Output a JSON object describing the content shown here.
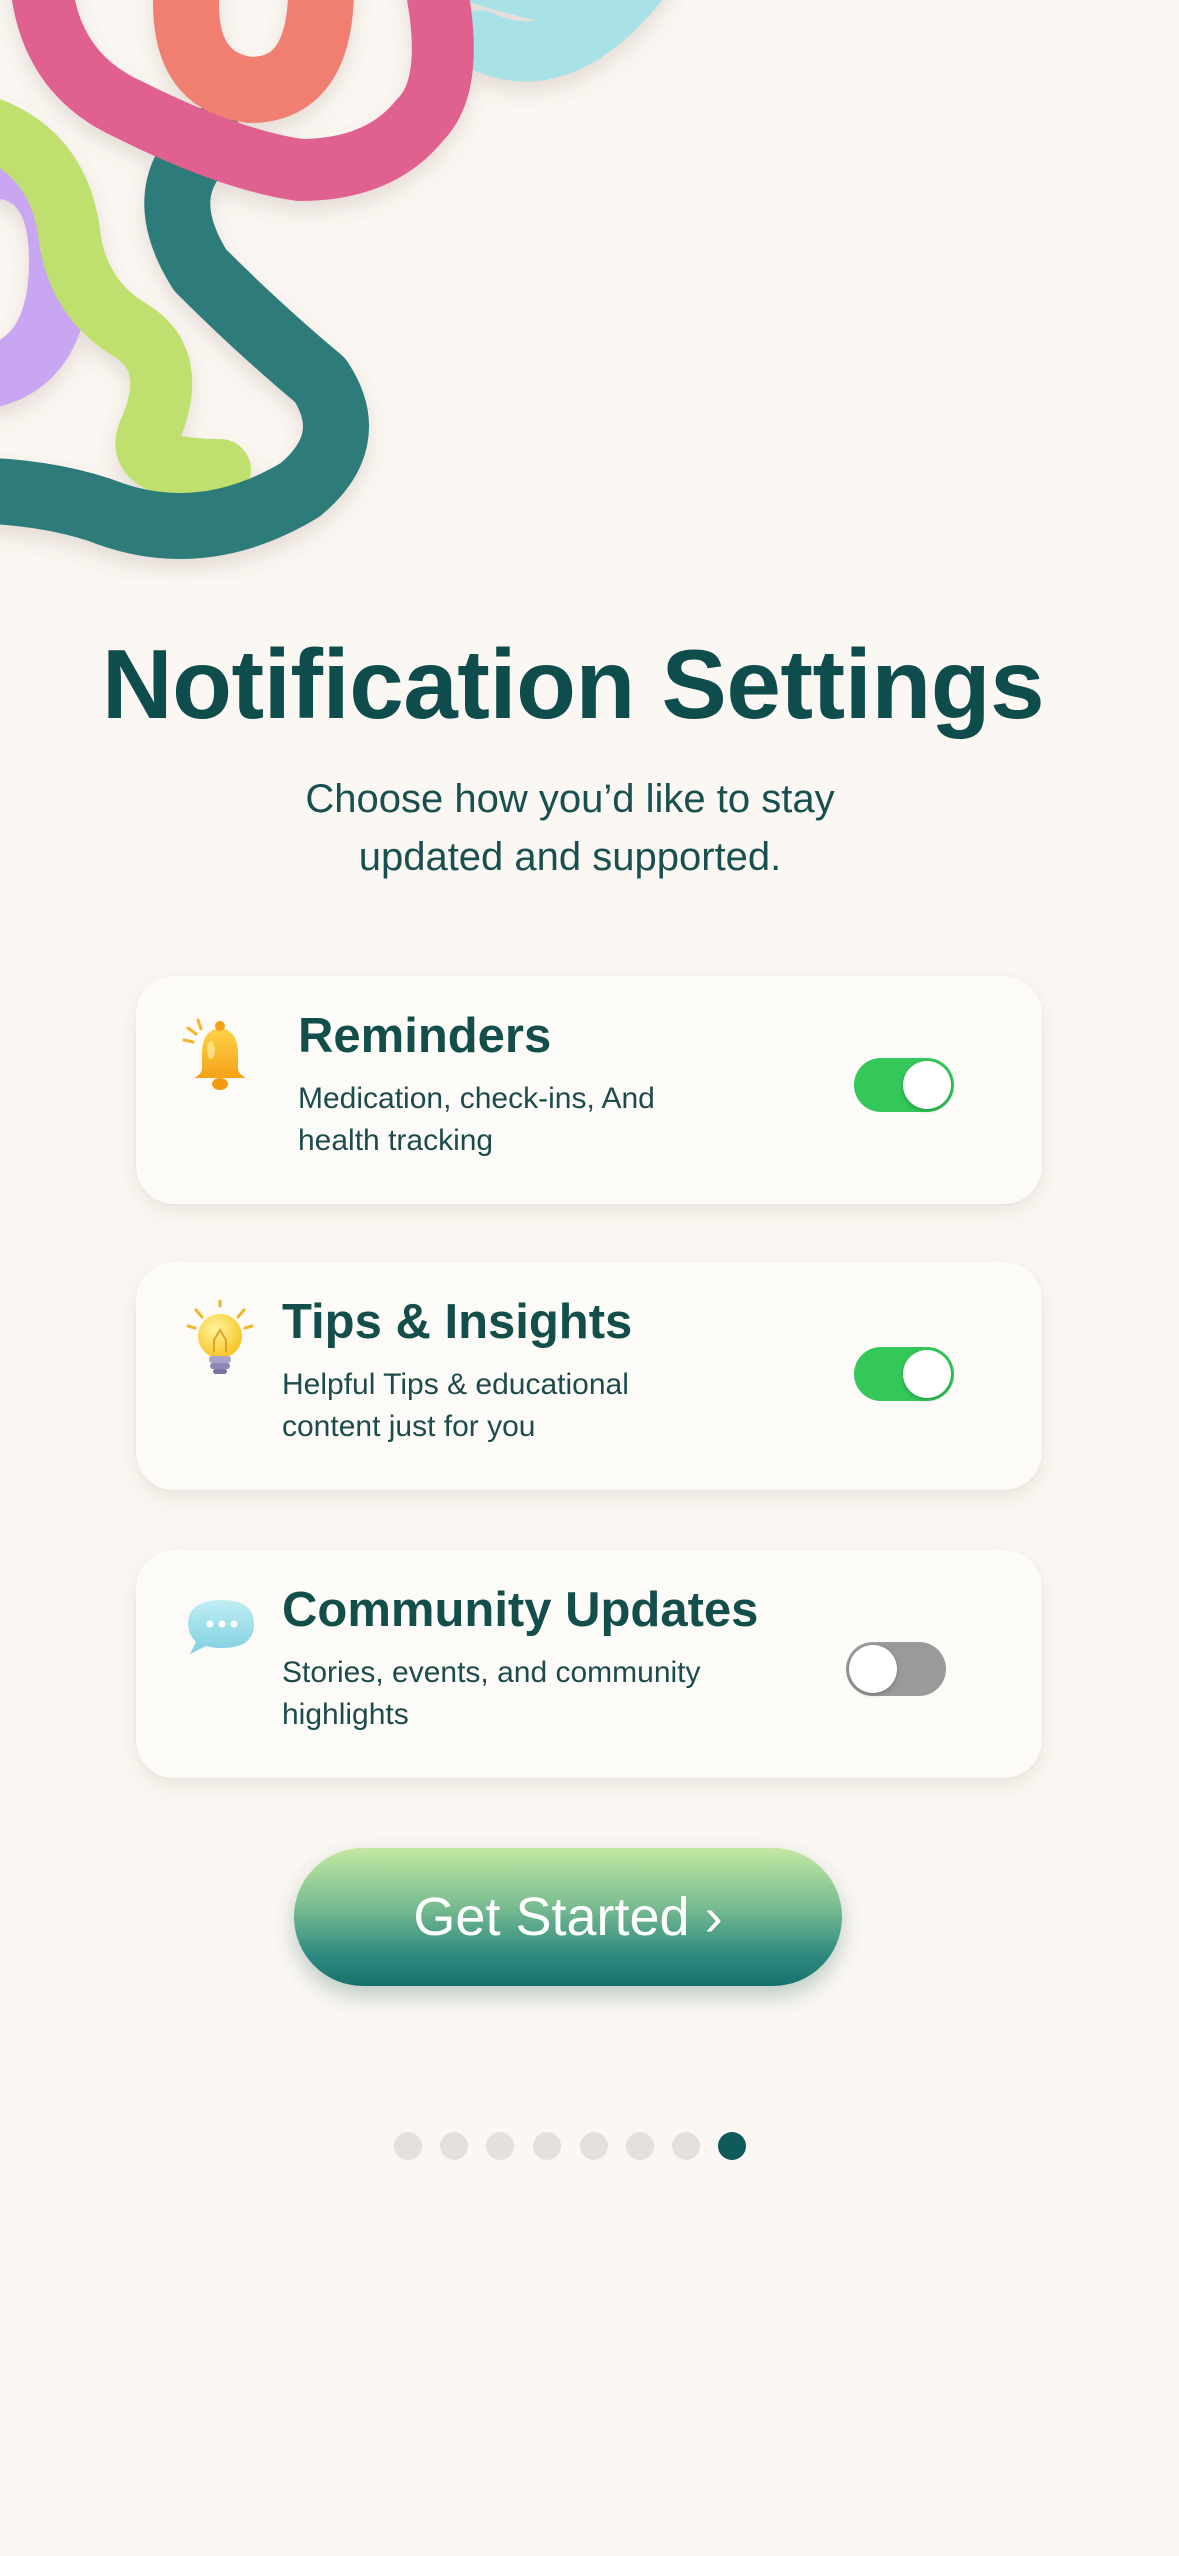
{
  "page": {
    "title": "Notification Settings",
    "subtitle": "Choose how you’d like to stay updated and supported."
  },
  "settings": [
    {
      "title": "Reminders",
      "description": "Medication, check-ins, And health tracking",
      "icon": "bell-icon",
      "enabled": true
    },
    {
      "title": "Tips & Insights",
      "description": "Helpful Tips & educational content just for you",
      "icon": "lightbulb-icon",
      "enabled": true
    },
    {
      "title": "Community Updates",
      "description": "Stories, events, and community highlights",
      "icon": "chat-bubble-icon",
      "enabled": false
    }
  ],
  "cta": {
    "label": "Get Started ›"
  },
  "pagination": {
    "total": 8,
    "current": 8
  },
  "colors": {
    "background": "#fbf7f2",
    "heading": "#0f4c4c",
    "toggle_on": "#34c759",
    "toggle_off": "#9a9a9a",
    "dot_active": "#0f5a5a",
    "dot_inactive": "#e4e0db"
  }
}
